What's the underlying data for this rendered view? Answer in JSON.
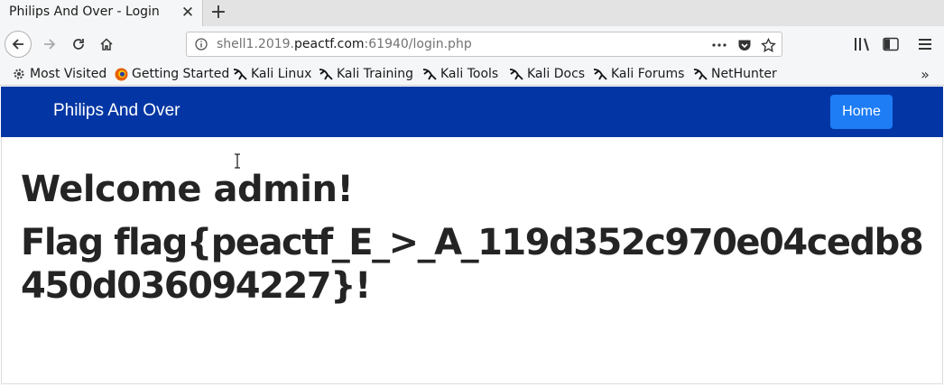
{
  "browser": {
    "tab_title": "Philips And Over - Login",
    "close_glyph": "✕",
    "newtab_glyph": "+",
    "url_prefix": "shell1.2019.",
    "url_domain": "peactf.com",
    "url_suffix": ":61940/login.php",
    "bookmarks": [
      {
        "label": "Most Visited",
        "icon": "gear-icon"
      },
      {
        "label": "Getting Started",
        "icon": "firefox-icon"
      },
      {
        "label": "Kali Linux",
        "icon": "kali-icon"
      },
      {
        "label": "Kali Training",
        "icon": "kali-icon"
      },
      {
        "label": "Kali Tools",
        "icon": "kali-icon"
      },
      {
        "label": "Kali Docs",
        "icon": "kali-icon"
      },
      {
        "label": "Kali Forums",
        "icon": "kali-icon"
      },
      {
        "label": "NetHunter",
        "icon": "kali-icon"
      }
    ],
    "overflow_glyph": "»"
  },
  "site": {
    "brand": "Philips And Over",
    "home_label": "Home",
    "accent": "#0336a4",
    "button_color": "#1e7cf5"
  },
  "main": {
    "welcome": "Welcome admin!",
    "flag_text": "Flag flag{peactf_E_>_A_119d352c970e04cedb8450d036094227}!"
  }
}
